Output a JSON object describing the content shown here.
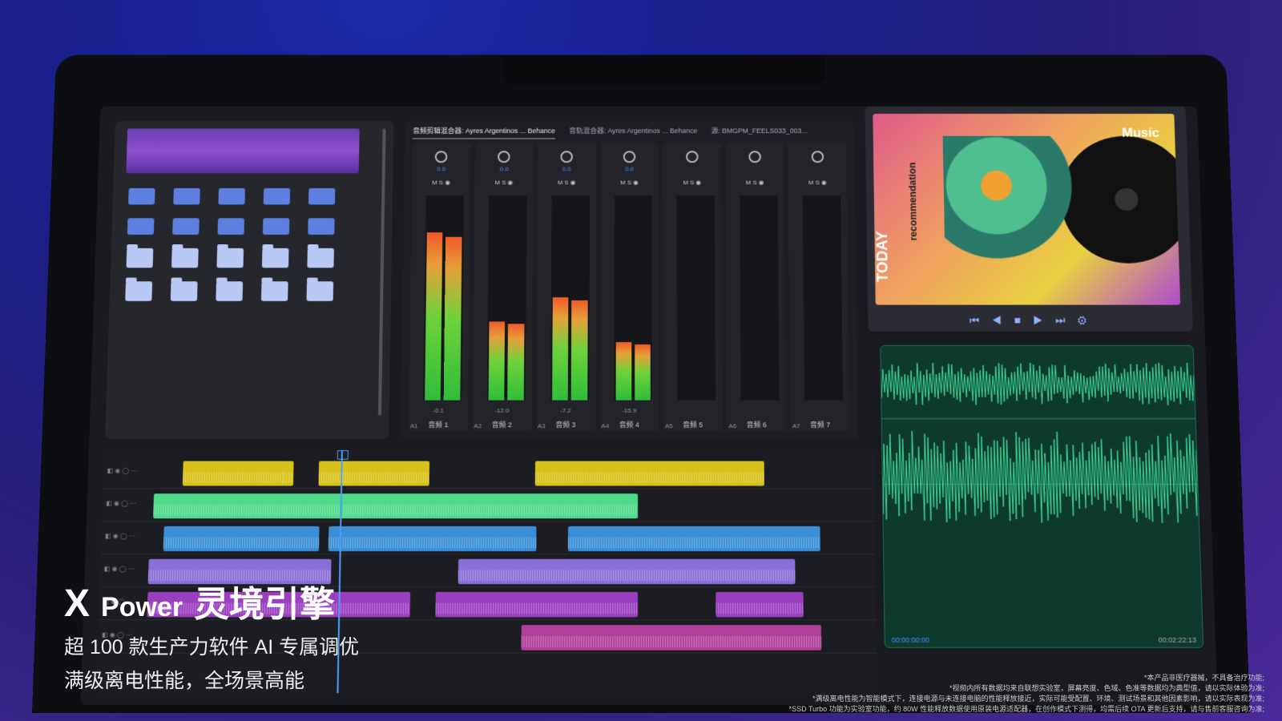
{
  "mixer": {
    "tabs": [
      "音频剪辑混合器: Ayres Argentinos ... Behance",
      "音轨混合器: Ayres Argentinos ... Behance",
      "源: BMGPM_FEELS033_003..."
    ],
    "channels": [
      {
        "id": "A1",
        "label": "音频 1",
        "knob": "0.0",
        "peak": "-0.1",
        "level": 0.82
      },
      {
        "id": "A2",
        "label": "音频 2",
        "knob": "0.0",
        "peak": "-12.0",
        "level": 0.38
      },
      {
        "id": "A3",
        "label": "音频 3",
        "knob": "0.0",
        "peak": "-7.2",
        "level": 0.5
      },
      {
        "id": "A4",
        "label": "音频 4",
        "knob": "0.0",
        "peak": "-15.9",
        "level": 0.28
      },
      {
        "id": "A5",
        "label": "音频 5",
        "knob": "",
        "peak": "",
        "level": 0
      },
      {
        "id": "A6",
        "label": "音频 6",
        "knob": "",
        "peak": "",
        "level": 0
      },
      {
        "id": "A7",
        "label": "音频 7",
        "knob": "",
        "peak": "",
        "level": 0
      }
    ]
  },
  "album": {
    "brand": "Music",
    "today": "TODAY",
    "recommendation": "recommendation",
    "transport": "⏮ ◀ ■ ▶ ⏭ ⚙"
  },
  "waveform": {
    "start": "00:00:00:00",
    "end": "00:02:22:13"
  },
  "overlay": {
    "brand_x": "X",
    "brand_power": "Power",
    "brand_cn": "灵境引擎",
    "line1": "超 100 款生产力软件 AI 专属调优",
    "line2": "满级离电性能，全场景高能"
  },
  "disclaimer": {
    "l1": "*本产品非医疗器械，不具备治疗功能;",
    "l2": "*视频内所有数据均来自联想实验室，屏幕亮度、色域、色准等数据均为典型值，请以实际体验为准;",
    "l3": "*满级离电性能为智能模式下，连接电源与未连接电脑的性能释放接近，实际可能受配置、环境、测试场景和其他因素影响，请以实际表现为准;",
    "l4": "*SSD Turbo 功能为实验室功能，约 80W 性能释放数据使用原装电源适配器，在创作模式下测得，均需后续 OTA 更新后支持，请与售前客服咨询为准;"
  },
  "colors": {
    "yellow": "#d8c21a",
    "green": "#4fd98a",
    "blue": "#3a8fd6",
    "violet": "#8a6fd8",
    "purple": "#9a3fc0",
    "magenta": "#b0409a"
  }
}
